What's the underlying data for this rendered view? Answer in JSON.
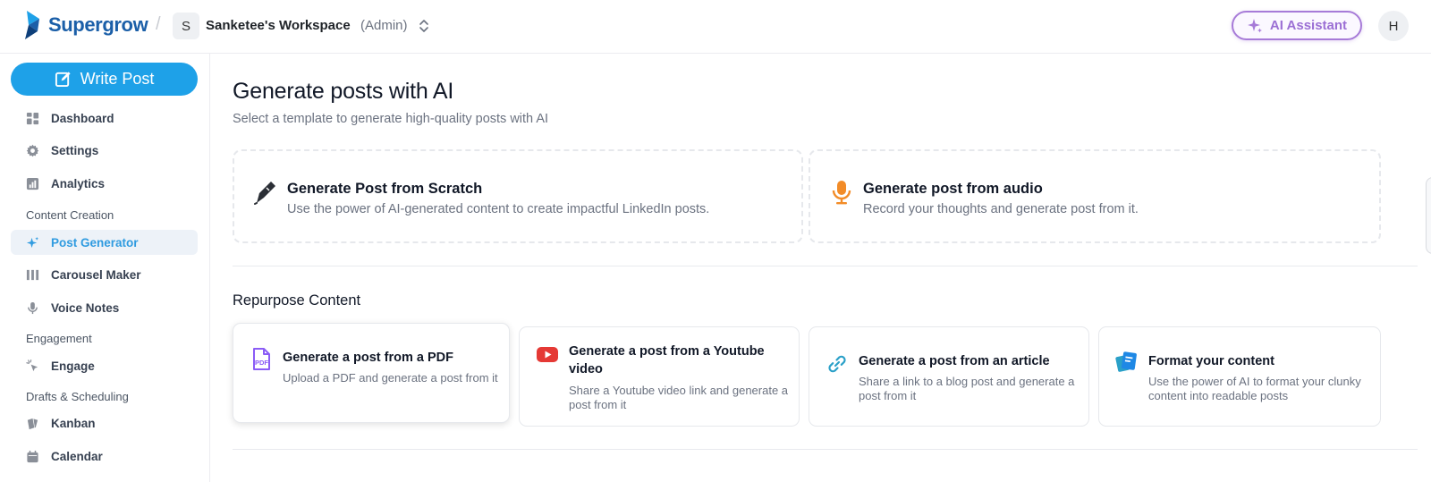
{
  "brand": {
    "name": "Supergrow"
  },
  "workspace": {
    "initial": "S",
    "name": "Sanketee's Workspace",
    "role": "(Admin)"
  },
  "header": {
    "ai_assistant_label": "AI Assistant",
    "user_initial": "H"
  },
  "sidebar": {
    "write_post_label": "Write Post",
    "items": [
      {
        "label": "Dashboard",
        "icon": "dashboard-icon"
      },
      {
        "label": "Settings",
        "icon": "gear-icon"
      },
      {
        "label": "Analytics",
        "icon": "bar-chart-icon"
      },
      {
        "label": "Post Generator",
        "icon": "sparkle-icon",
        "active": true
      },
      {
        "label": "Carousel Maker",
        "icon": "columns-icon"
      },
      {
        "label": "Voice Notes",
        "icon": "microphone-icon"
      },
      {
        "label": "Engage",
        "icon": "cursor-click-icon"
      },
      {
        "label": "Kanban",
        "icon": "cards-icon"
      },
      {
        "label": "Calendar",
        "icon": "calendar-icon"
      }
    ],
    "sections": [
      "Content Creation",
      "Engagement",
      "Drafts & Scheduling"
    ]
  },
  "main": {
    "title": "Generate posts with AI",
    "subtitle": "Select a template to generate high-quality posts with AI",
    "primary_cards": [
      {
        "title": "Generate Post from Scratch",
        "desc": "Use the power of AI-generated content to create impactful LinkedIn posts.",
        "icon": "pen-icon"
      },
      {
        "title": "Generate post from audio",
        "desc": "Record your thoughts and generate post from it.",
        "icon": "microphone-icon"
      }
    ],
    "repurpose_title": "Repurpose Content",
    "repurpose_cards": [
      {
        "title": "Generate a post from a PDF",
        "desc": "Upload a PDF and generate a post from it",
        "icon": "pdf-file-icon"
      },
      {
        "title": "Generate a post from a Youtube video",
        "desc": "Share a Youtube video link and generate a post from it",
        "icon": "youtube-icon"
      },
      {
        "title": "Generate a post from an article",
        "desc": "Share a link to a blog post and generate a post from it",
        "icon": "link-icon"
      },
      {
        "title": "Format your content",
        "desc": "Use the power of AI to format your clunky content into readable posts",
        "icon": "format-icon"
      }
    ]
  },
  "colors": {
    "brand_blue": "#1b5fa8",
    "primary": "#1ea1e8",
    "ai_purple": "#9b6fd4",
    "active_bg": "#edf2f8",
    "youtube_red": "#e53935",
    "audio_orange": "#f28c28"
  }
}
